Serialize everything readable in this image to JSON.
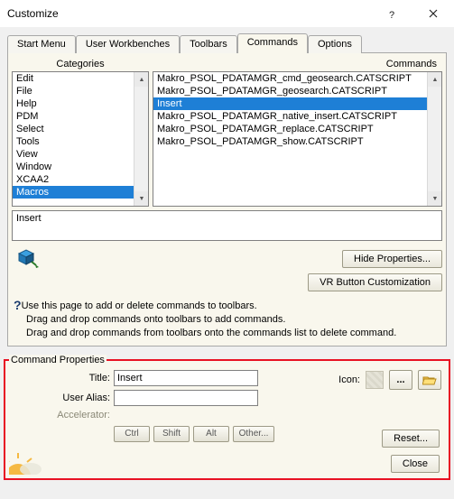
{
  "window": {
    "title": "Customize"
  },
  "tabs": [
    "Start Menu",
    "User Workbenches",
    "Toolbars",
    "Commands",
    "Options"
  ],
  "activeTab": "Commands",
  "headers": {
    "categories": "Categories",
    "commands": "Commands"
  },
  "categories": [
    "Edit",
    "File",
    "Help",
    "PDM",
    "Select",
    "Tools",
    "View",
    "Window",
    "XCAA2",
    "Macros"
  ],
  "selectedCategory": "Macros",
  "commands": [
    "Makro_PSOL_PDATAMGR_cmd_geosearch.CATSCRIPT",
    "Makro_PSOL_PDATAMGR_geosearch.CATSCRIPT",
    "Insert",
    "Makro_PSOL_PDATAMGR_native_insert.CATSCRIPT",
    "Makro_PSOL_PDATAMGR_replace.CATSCRIPT",
    "Makro_PSOL_PDATAMGR_show.CATSCRIPT"
  ],
  "selectedCommand": "Insert",
  "preview": "Insert",
  "buttons": {
    "hideProps": "Hide Properties...",
    "vrCustom": "VR Button Customization",
    "reset": "Reset...",
    "close": "Close"
  },
  "tip": {
    "line1": "Use this page to add or delete commands to toolbars.",
    "line2": "Drag and drop commands onto toolbars to add commands.",
    "line3": "Drag and drop commands from toolbars onto the commands list to delete command."
  },
  "props": {
    "legend": "Command Properties",
    "labels": {
      "title": "Title:",
      "alias": "User Alias:",
      "accel": "Accelerator:",
      "icon": "Icon:"
    },
    "values": {
      "title": "Insert",
      "alias": ""
    },
    "mods": {
      "ctrl": "Ctrl",
      "shift": "Shift",
      "alt": "Alt",
      "other": "Other..."
    },
    "browseDots": "..."
  }
}
